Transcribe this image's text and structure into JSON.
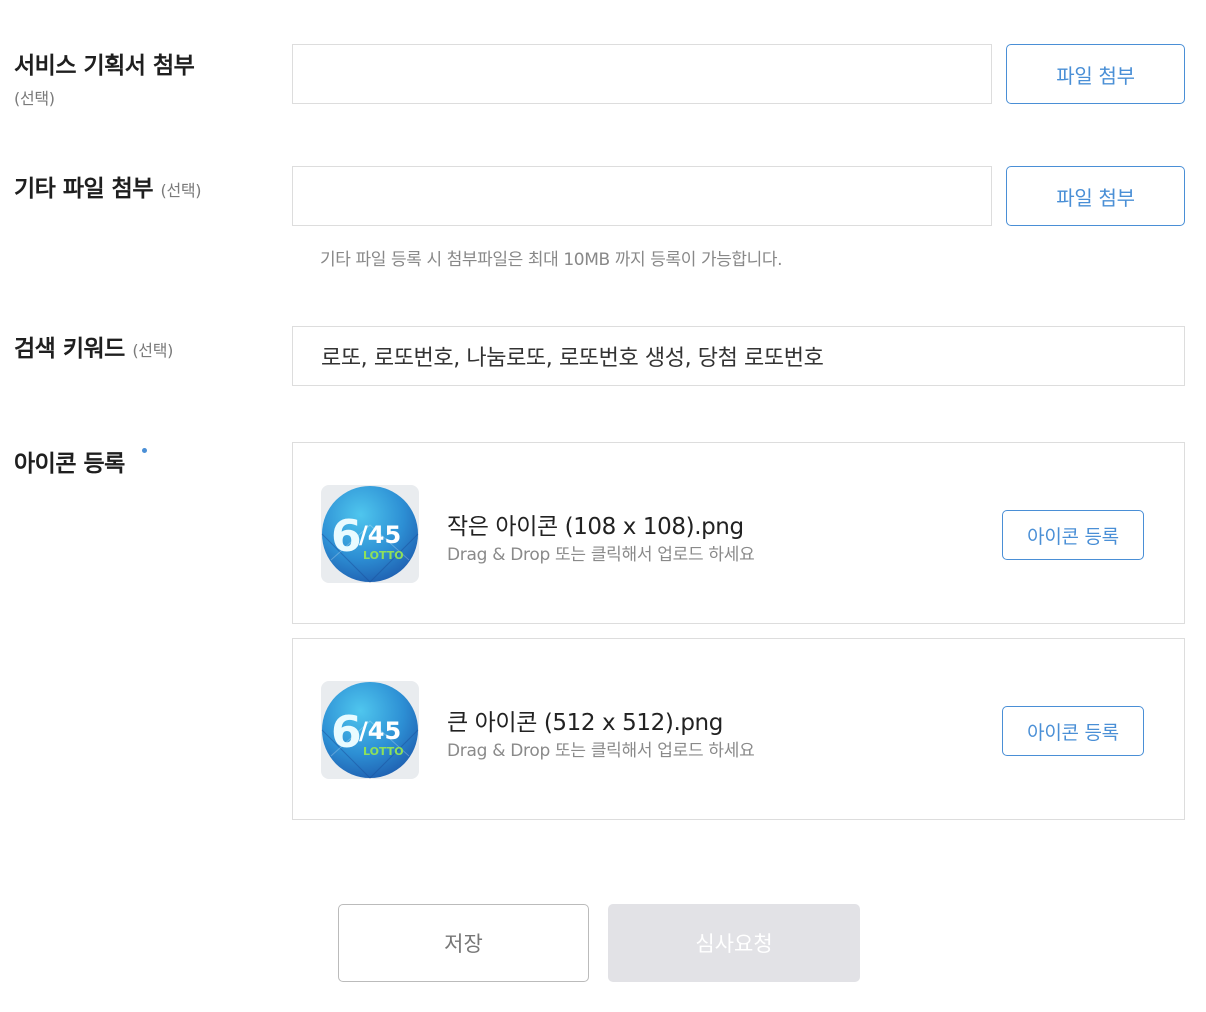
{
  "service_plan": {
    "label": "서비스 기획서 첨부",
    "optional": "(선택)",
    "value": "",
    "button": "파일 첨부"
  },
  "other_file": {
    "label": "기타 파일 첨부",
    "optional": "(선택)",
    "value": "",
    "button": "파일 첨부",
    "hint": "기타 파일 등록 시 첨부파일은 최대 10MB 까지 등록이 가능합니다."
  },
  "keywords": {
    "label": "검색 키워드",
    "optional": "(선택)",
    "value": "로또, 로또번호, 나눔로또, 로또번호 생성, 당첨 로또번호"
  },
  "icon_register": {
    "label": "아이콘 등록",
    "required_mark_color": "#4a8fd6",
    "items": [
      {
        "thumb_logo_top": "6/45",
        "thumb_logo_bottom": "LOTTO",
        "name": "작은 아이콘 (108 x 108).png",
        "desc": "Drag & Drop 또는 클릭해서 업로드 하세요",
        "button": "아이콘 등록"
      },
      {
        "thumb_logo_top": "6/45",
        "thumb_logo_bottom": "LOTTO",
        "name": "큰 아이콘 (512 x 512).png",
        "desc": "Drag & Drop 또는 클릭해서 업로드 하세요",
        "button": "아이콘 등록"
      }
    ]
  },
  "actions": {
    "save": "저장",
    "review": "심사요청"
  },
  "colors": {
    "accent": "#4a8fd6",
    "disabled_button": "#e2e2e6",
    "border": "#dddddd"
  }
}
